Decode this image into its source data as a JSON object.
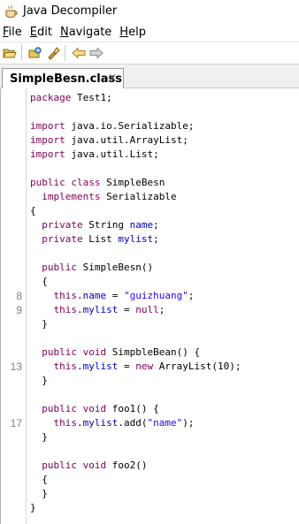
{
  "window": {
    "title": "Java Decompiler"
  },
  "menu": [
    {
      "mn": "F",
      "rest": "ile"
    },
    {
      "mn": "E",
      "rest": "dit"
    },
    {
      "mn": "N",
      "rest": "avigate"
    },
    {
      "mn": "H",
      "rest": "elp"
    }
  ],
  "tab": {
    "label": "SimpleBesn.class",
    "close": "×"
  },
  "code": [
    {
      "ln": "",
      "tokens": [
        [
          "kw",
          "package"
        ],
        [
          "txt",
          " Test1;"
        ]
      ]
    },
    {
      "ln": "",
      "tokens": []
    },
    {
      "ln": "",
      "tokens": [
        [
          "kw",
          "import"
        ],
        [
          "txt",
          " java.io.Serializable;"
        ]
      ]
    },
    {
      "ln": "",
      "tokens": [
        [
          "kw",
          "import"
        ],
        [
          "txt",
          " java.util.ArrayList;"
        ]
      ]
    },
    {
      "ln": "",
      "tokens": [
        [
          "kw",
          "import"
        ],
        [
          "txt",
          " java.util.List;"
        ]
      ]
    },
    {
      "ln": "",
      "tokens": []
    },
    {
      "ln": "",
      "tokens": [
        [
          "kw",
          "public"
        ],
        [
          "txt",
          " "
        ],
        [
          "kw",
          "class"
        ],
        [
          "txt",
          " SimpleBesn"
        ]
      ]
    },
    {
      "ln": "",
      "tokens": [
        [
          "txt",
          "  "
        ],
        [
          "kw",
          "implements"
        ],
        [
          "txt",
          " Serializable"
        ]
      ]
    },
    {
      "ln": "",
      "tokens": [
        [
          "txt",
          "{"
        ]
      ]
    },
    {
      "ln": "",
      "tokens": [
        [
          "txt",
          "  "
        ],
        [
          "kw",
          "private"
        ],
        [
          "txt",
          " String "
        ],
        [
          "fld",
          "name"
        ],
        [
          "txt",
          ";"
        ]
      ]
    },
    {
      "ln": "",
      "tokens": [
        [
          "txt",
          "  "
        ],
        [
          "kw",
          "private"
        ],
        [
          "txt",
          " List "
        ],
        [
          "fld",
          "mylist"
        ],
        [
          "txt",
          ";"
        ]
      ]
    },
    {
      "ln": "",
      "tokens": []
    },
    {
      "ln": "",
      "tokens": [
        [
          "txt",
          "  "
        ],
        [
          "kw",
          "public"
        ],
        [
          "txt",
          " SimpleBesn()"
        ]
      ]
    },
    {
      "ln": "",
      "tokens": [
        [
          "txt",
          "  {"
        ]
      ]
    },
    {
      "ln": "8",
      "tokens": [
        [
          "txt",
          "    "
        ],
        [
          "kw",
          "this"
        ],
        [
          "txt",
          "."
        ],
        [
          "fld",
          "name"
        ],
        [
          "txt",
          " = "
        ],
        [
          "str",
          "\"guizhuang\""
        ],
        [
          "txt",
          ";"
        ]
      ]
    },
    {
      "ln": "9",
      "tokens": [
        [
          "txt",
          "    "
        ],
        [
          "kw",
          "this"
        ],
        [
          "txt",
          "."
        ],
        [
          "fld",
          "mylist"
        ],
        [
          "txt",
          " = "
        ],
        [
          "kw",
          "null"
        ],
        [
          "txt",
          ";"
        ]
      ]
    },
    {
      "ln": "",
      "tokens": [
        [
          "txt",
          "  }"
        ]
      ]
    },
    {
      "ln": "",
      "tokens": []
    },
    {
      "ln": "",
      "tokens": [
        [
          "txt",
          "  "
        ],
        [
          "kw",
          "public"
        ],
        [
          "txt",
          " "
        ],
        [
          "kw",
          "void"
        ],
        [
          "txt",
          " SimpbleBean() {"
        ]
      ]
    },
    {
      "ln": "13",
      "tokens": [
        [
          "txt",
          "    "
        ],
        [
          "kw",
          "this"
        ],
        [
          "txt",
          "."
        ],
        [
          "fld",
          "mylist"
        ],
        [
          "txt",
          " = "
        ],
        [
          "kw",
          "new"
        ],
        [
          "txt",
          " ArrayList(10);"
        ]
      ]
    },
    {
      "ln": "",
      "tokens": [
        [
          "txt",
          "  }"
        ]
      ]
    },
    {
      "ln": "",
      "tokens": []
    },
    {
      "ln": "",
      "tokens": [
        [
          "txt",
          "  "
        ],
        [
          "kw",
          "public"
        ],
        [
          "txt",
          " "
        ],
        [
          "kw",
          "void"
        ],
        [
          "txt",
          " foo1() {"
        ]
      ]
    },
    {
      "ln": "17",
      "tokens": [
        [
          "txt",
          "    "
        ],
        [
          "kw",
          "this"
        ],
        [
          "txt",
          "."
        ],
        [
          "fld",
          "mylist"
        ],
        [
          "txt",
          ".add("
        ],
        [
          "str",
          "\"name\""
        ],
        [
          "txt",
          ");"
        ]
      ]
    },
    {
      "ln": "",
      "tokens": [
        [
          "txt",
          "  }"
        ]
      ]
    },
    {
      "ln": "",
      "tokens": []
    },
    {
      "ln": "",
      "tokens": [
        [
          "txt",
          "  "
        ],
        [
          "kw",
          "public"
        ],
        [
          "txt",
          " "
        ],
        [
          "kw",
          "void"
        ],
        [
          "txt",
          " foo2()"
        ]
      ]
    },
    {
      "ln": "",
      "tokens": [
        [
          "txt",
          "  {"
        ]
      ]
    },
    {
      "ln": "",
      "tokens": [
        [
          "txt",
          "  }"
        ]
      ]
    },
    {
      "ln": "",
      "tokens": [
        [
          "txt",
          "}"
        ]
      ]
    }
  ]
}
